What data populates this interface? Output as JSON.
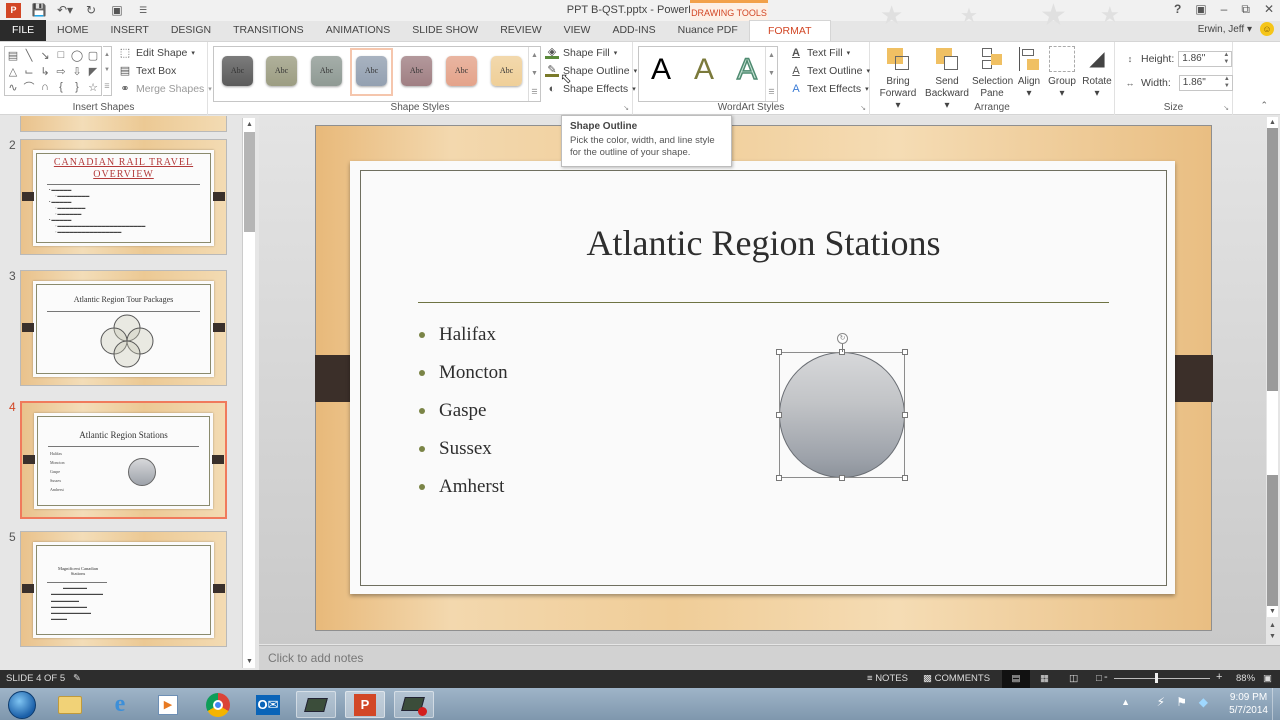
{
  "window": {
    "title": "PPT B-QST.pptx - PowerPoint",
    "controls": [
      "help-icon",
      "ribbon-display-icon",
      "minimize-icon",
      "restore-icon",
      "close-icon"
    ],
    "user": "Erwin, Jeff"
  },
  "quick_access": [
    "save-icon",
    "undo-icon",
    "redo-icon",
    "start-from-beginning-icon",
    "customize-qat-icon"
  ],
  "contextual_tab_group": "DRAWING TOOLS",
  "tabs": [
    {
      "label": "FILE"
    },
    {
      "label": "HOME"
    },
    {
      "label": "INSERT"
    },
    {
      "label": "DESIGN"
    },
    {
      "label": "TRANSITIONS"
    },
    {
      "label": "ANIMATIONS"
    },
    {
      "label": "SLIDE SHOW"
    },
    {
      "label": "REVIEW"
    },
    {
      "label": "VIEW"
    },
    {
      "label": "ADD-INS"
    },
    {
      "label": "Nuance PDF"
    },
    {
      "label": "FORMAT",
      "active": true
    }
  ],
  "ribbon": {
    "insert_shapes": {
      "label": "Insert Shapes",
      "edit_shape": "Edit Shape",
      "text_box": "Text Box",
      "merge_shapes": "Merge Shapes"
    },
    "shape_styles": {
      "label": "Shape Styles",
      "swatch_text": "Abc",
      "swatch_colors": [
        "#5b5b5b",
        "#9c9d82",
        "#8f9a94",
        "#93a0b1",
        "#a07f83",
        "#e4a38a",
        "#efcf98"
      ],
      "selected_swatch": 3,
      "shape_fill": "Shape Fill",
      "shape_outline": "Shape Outline",
      "shape_effects": "Shape Effects"
    },
    "wordart_styles": {
      "label": "WordArt Styles",
      "letter": "A",
      "text_fill": "Text Fill",
      "text_outline": "Text Outline",
      "text_effects": "Text Effects"
    },
    "arrange": {
      "label": "Arrange",
      "bring_forward": [
        "Bring",
        "Forward"
      ],
      "send_backward": [
        "Send",
        "Backward"
      ],
      "selection_pane": [
        "Selection",
        "Pane"
      ],
      "align": "Align",
      "group": "Group",
      "rotate": "Rotate"
    },
    "size": {
      "label": "Size",
      "height_label": "Height:",
      "height_value": "1.86\"",
      "width_label": "Width:",
      "width_value": "1.86\""
    }
  },
  "tooltip": {
    "title": "Shape Outline",
    "body": "Pick the color, width, and line style for the outline of your shape."
  },
  "thumbnails": [
    {
      "number": "2",
      "title_line1": "CANADIAN RAIL TRAVEL",
      "title_line2": "OVERVIEW"
    },
    {
      "number": "3",
      "title": "Atlantic Region Tour Packages"
    },
    {
      "number": "4",
      "title": "Atlantic Region Stations",
      "selected": true
    },
    {
      "number": "5",
      "title_line1": "Magnificent Canadian",
      "title_line2": "Stations"
    }
  ],
  "slide": {
    "title": "Atlantic Region Stations",
    "bullets": [
      "Halifax",
      "Moncton",
      "Gaspe",
      "Sussex",
      "Amherst"
    ]
  },
  "notes_placeholder": "Click to add notes",
  "status": {
    "slide_indicator": "SLIDE 4 OF 5",
    "notes": "NOTES",
    "comments": "COMMENTS",
    "zoom_percent": "88%",
    "zoom_level": 88
  },
  "taskbar": {
    "apps": [
      "start-orb-icon",
      "file-explorer-icon",
      "internet-explorer-icon",
      "media-player-icon",
      "chrome-icon",
      "outlook-icon",
      "app-icon",
      "powerpoint-icon",
      "recorder-icon"
    ],
    "time": "9:09 PM",
    "date": "5/7/2014"
  }
}
